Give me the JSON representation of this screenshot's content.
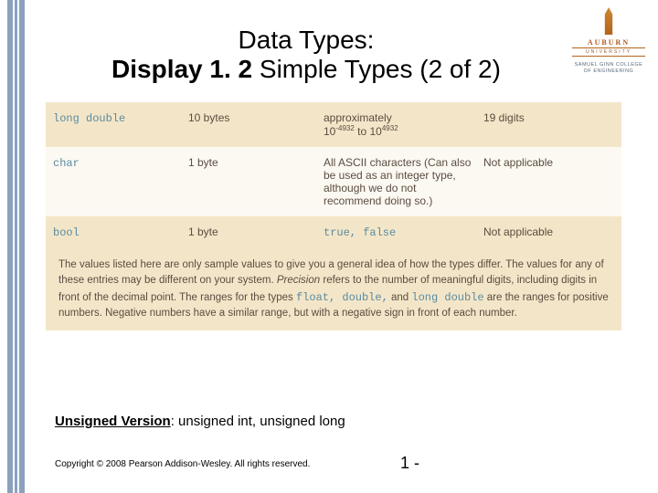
{
  "logo": {
    "line1": "AUBURN",
    "line2": "UNIVERSITY",
    "line3": "SAMUEL GINN\nCOLLEGE OF ENGINEERING"
  },
  "title": {
    "line1": "Data Types:",
    "line2_bold": "Display 1. 2",
    "line2_rest": "  Simple Types (2 of 2)"
  },
  "rows": [
    {
      "type": "long double",
      "size": "10 bytes",
      "val_html": "approximately<br>10<sup class='sup'>-4932</sup> to 10<sup class='sup'>4932</sup>",
      "prec": "19 digits"
    },
    {
      "type": "char",
      "size": "1 byte",
      "val": "All ASCII characters (Can also be used as an integer type, although we do not recommend doing so.)",
      "prec": "Not applicable"
    },
    {
      "type": "bool",
      "size": "1 byte",
      "val_code": "true, false",
      "prec": "Not applicable"
    }
  ],
  "note": {
    "pre": "The values listed here are only sample values to give you a general idea of how the types differ. The values for any of these entries may be different on your system. ",
    "prec_word": "Precision",
    "mid": " refers to the number of meaningful digits, including digits in front of the decimal point. The ranges for the types ",
    "code": "float, double,",
    "and": " and ",
    "code2": "long double",
    "post": " are the ranges for positive numbers. Negative numbers have a similar range, but with a negative sign in front of each number."
  },
  "unsigned": {
    "label": "Unsigned Version",
    "rest": ": unsigned int, unsigned long"
  },
  "copyright": "Copyright © 2008 Pearson Addison-Wesley. All rights reserved.",
  "pagenum": "1 -"
}
